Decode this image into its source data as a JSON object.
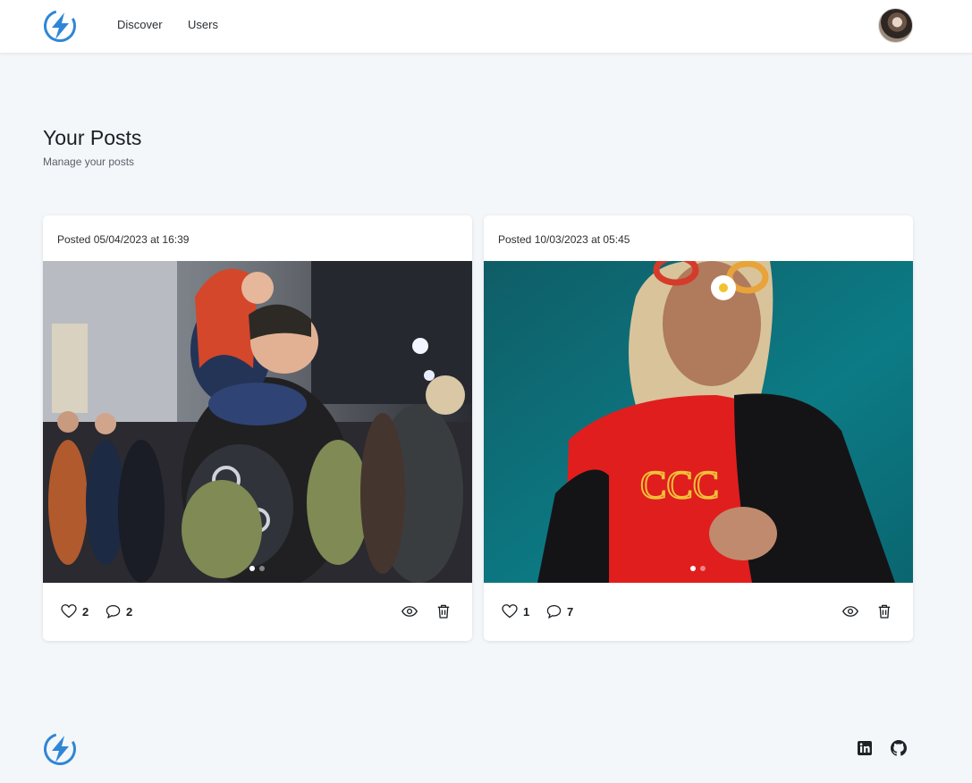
{
  "nav": {
    "discover_label": "Discover",
    "users_label": "Users"
  },
  "page": {
    "title": "Your Posts",
    "subtitle": "Manage your posts"
  },
  "posts": [
    {
      "date_text": "Posted 05/04/2023 at 16:39",
      "likes": "2",
      "comments": "2",
      "carousel_active_index": 0,
      "carousel_count": 2
    },
    {
      "date_text": "Posted 10/03/2023 at 05:45",
      "likes": "1",
      "comments": "7",
      "carousel_active_index": 0,
      "carousel_count": 2
    }
  ],
  "icons": {
    "brand": "lightning-bolt-circle-icon",
    "like": "heart-outline-icon",
    "comment": "speech-bubble-icon",
    "view": "eye-icon",
    "delete": "trash-icon",
    "linkedin": "linkedin-icon",
    "github": "github-icon"
  },
  "colors": {
    "brand_blue": "#2f86d6",
    "page_bg": "#f4f7fa",
    "card_bg": "#ffffff"
  }
}
